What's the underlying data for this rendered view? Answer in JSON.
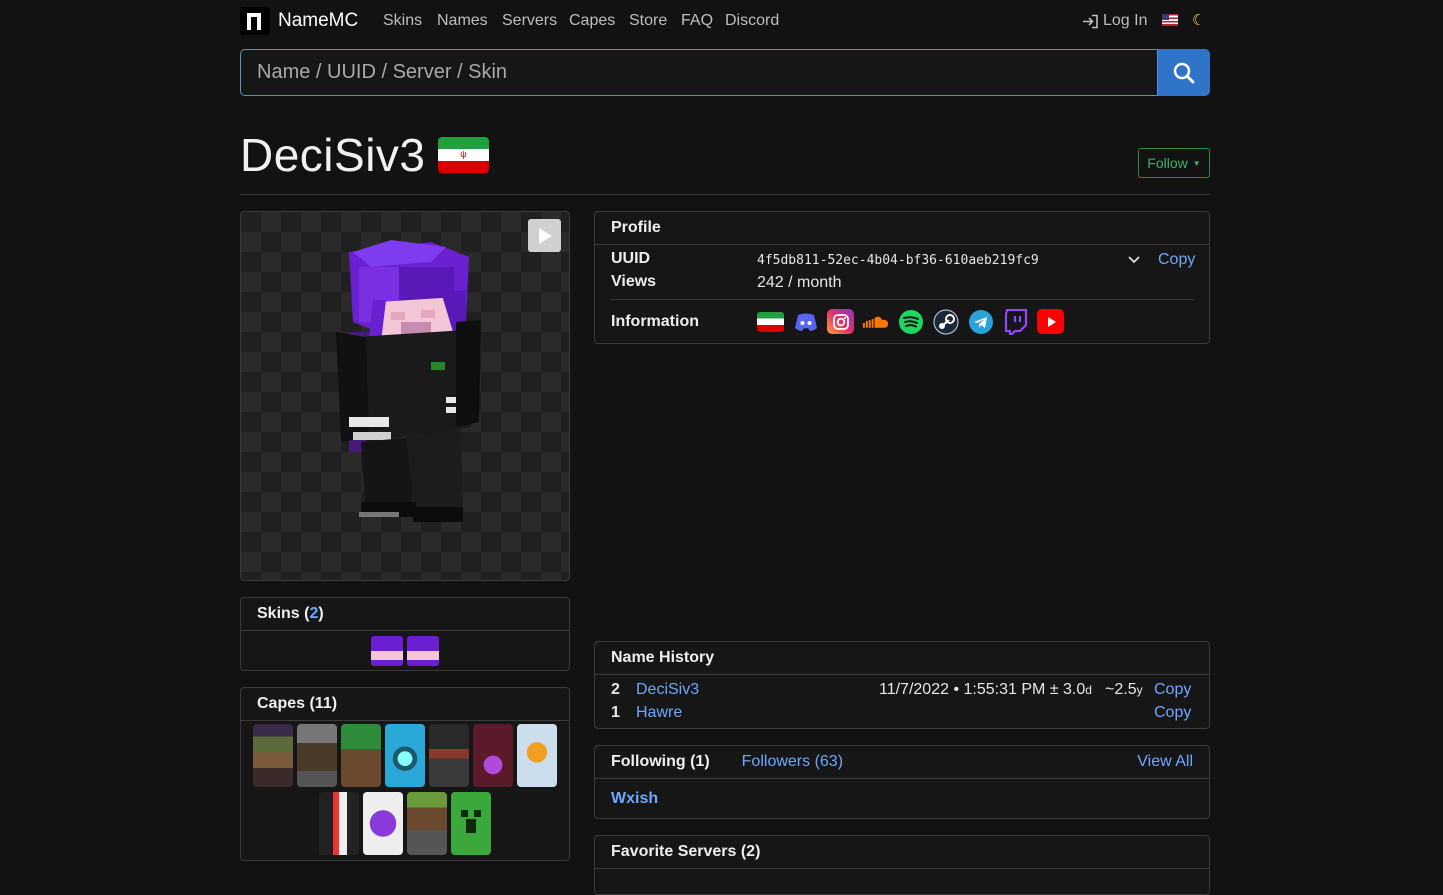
{
  "nav": {
    "brand": "NameMC",
    "items": [
      "Skins",
      "Names",
      "Servers",
      "Capes",
      "Store",
      "FAQ",
      "Discord"
    ],
    "login": "Log In"
  },
  "search": {
    "placeholder": "Name / UUID / Server / Skin"
  },
  "player": {
    "name": "DeciSiv3",
    "follow": "Follow"
  },
  "profile": {
    "title": "Profile",
    "uuid_label": "UUID",
    "uuid": "4f5db811-52ec-4b04-bf36-610aeb219fc9",
    "copy": "Copy",
    "views_label": "Views",
    "views": "242 / month",
    "info_label": "Information",
    "icons": [
      "iran-flag-icon",
      "discord-icon",
      "instagram-icon",
      "soundcloud-icon",
      "spotify-icon",
      "steam-icon",
      "telegram-icon",
      "twitch-icon",
      "youtube-icon"
    ]
  },
  "skins": {
    "title": "Skins (",
    "count": "2",
    "close": ")"
  },
  "capes": {
    "title": "Capes (11)"
  },
  "name_history": {
    "title": "Name History",
    "rows": [
      {
        "num": "2",
        "name": "DeciSiv3",
        "date": "11/7/2022 • 1:55:31 PM ± 3.0",
        "date_unit": "d",
        "age": "~2.5",
        "age_unit": "y",
        "copy": "Copy"
      },
      {
        "num": "1",
        "name": "Hawre",
        "copy": "Copy"
      }
    ]
  },
  "following": {
    "following": "Following (1)",
    "followers": "Followers (63)",
    "view_all": "View All",
    "user": "Wxish"
  },
  "favorite_servers": {
    "title": "Favorite Servers (2)"
  },
  "colors": {
    "accent": "#2e74c9",
    "link": "#6ea8fe",
    "follow": "#3fb164",
    "bg": "#121212"
  }
}
